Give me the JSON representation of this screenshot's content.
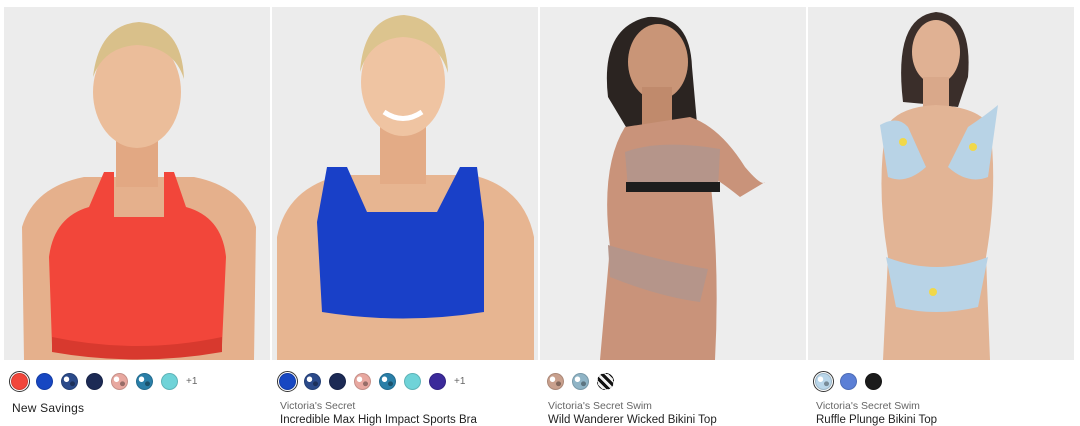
{
  "products": [
    {
      "brand_label": "New Savings",
      "title": "",
      "more_label": "+1",
      "swatches": [
        {
          "name": "coral",
          "color": "#f2463a",
          "selected": true
        },
        {
          "name": "royal-blue",
          "color": "#1747c2"
        },
        {
          "name": "navy-print",
          "color": "#2b4a8a",
          "pattern": "print"
        },
        {
          "name": "navy",
          "color": "#1c2a55"
        },
        {
          "name": "pink-print",
          "color": "#e8a8a0",
          "pattern": "print"
        },
        {
          "name": "teal-print",
          "color": "#2a7fa8",
          "pattern": "print"
        },
        {
          "name": "aqua",
          "color": "#6fd3d8"
        }
      ]
    },
    {
      "brand_label": "Victoria's Secret",
      "title": "Incredible Max High Impact Sports Bra",
      "more_label": "+1",
      "swatches": [
        {
          "name": "royal-blue",
          "color": "#1747c2",
          "selected": true
        },
        {
          "name": "navy-print",
          "color": "#2b4a8a",
          "pattern": "print"
        },
        {
          "name": "navy",
          "color": "#1c2a55"
        },
        {
          "name": "pink-print",
          "color": "#e8a8a0",
          "pattern": "print"
        },
        {
          "name": "teal-print",
          "color": "#2a7fa8",
          "pattern": "print"
        },
        {
          "name": "aqua",
          "color": "#6fd3d8"
        },
        {
          "name": "purple",
          "color": "#3b2a9a"
        }
      ]
    },
    {
      "brand_label": "Victoria's Secret Swim",
      "title": "Wild Wanderer Wicked Bikini Top",
      "more_label": "",
      "swatches": [
        {
          "name": "leopard",
          "color": "#c9a08d",
          "pattern": "print"
        },
        {
          "name": "blue-leopard",
          "color": "#8fb4c6",
          "pattern": "print"
        },
        {
          "name": "zebra",
          "color": "#444444",
          "pattern": "stripe"
        }
      ]
    },
    {
      "brand_label": "Victoria's Secret Swim",
      "title": "Ruffle Plunge Bikini Top",
      "more_label": "",
      "swatches": [
        {
          "name": "lemon-print",
          "color": "#b9d6ea",
          "pattern": "print",
          "selected": true
        },
        {
          "name": "periwinkle",
          "color": "#5b7fd6"
        },
        {
          "name": "black",
          "color": "#1b1b1b"
        }
      ]
    }
  ],
  "images": [
    {
      "icon": "product-photo-coral-sports-bra",
      "garment": "#f2463a",
      "hair": "#d9c08a",
      "bg": "#ececec"
    },
    {
      "icon": "product-photo-blue-sports-bra",
      "garment": "#1940c8",
      "hair": "#dcc48e",
      "bg": "#ececec"
    },
    {
      "icon": "product-photo-leopard-bikini",
      "garment": "#b5958a",
      "hair": "#2b2421",
      "bg": "#ededed"
    },
    {
      "icon": "product-photo-lemon-ruffle-bikini",
      "garment": "#b8d3e6",
      "hair": "#3a2e2a",
      "bg": "#ececec"
    }
  ]
}
